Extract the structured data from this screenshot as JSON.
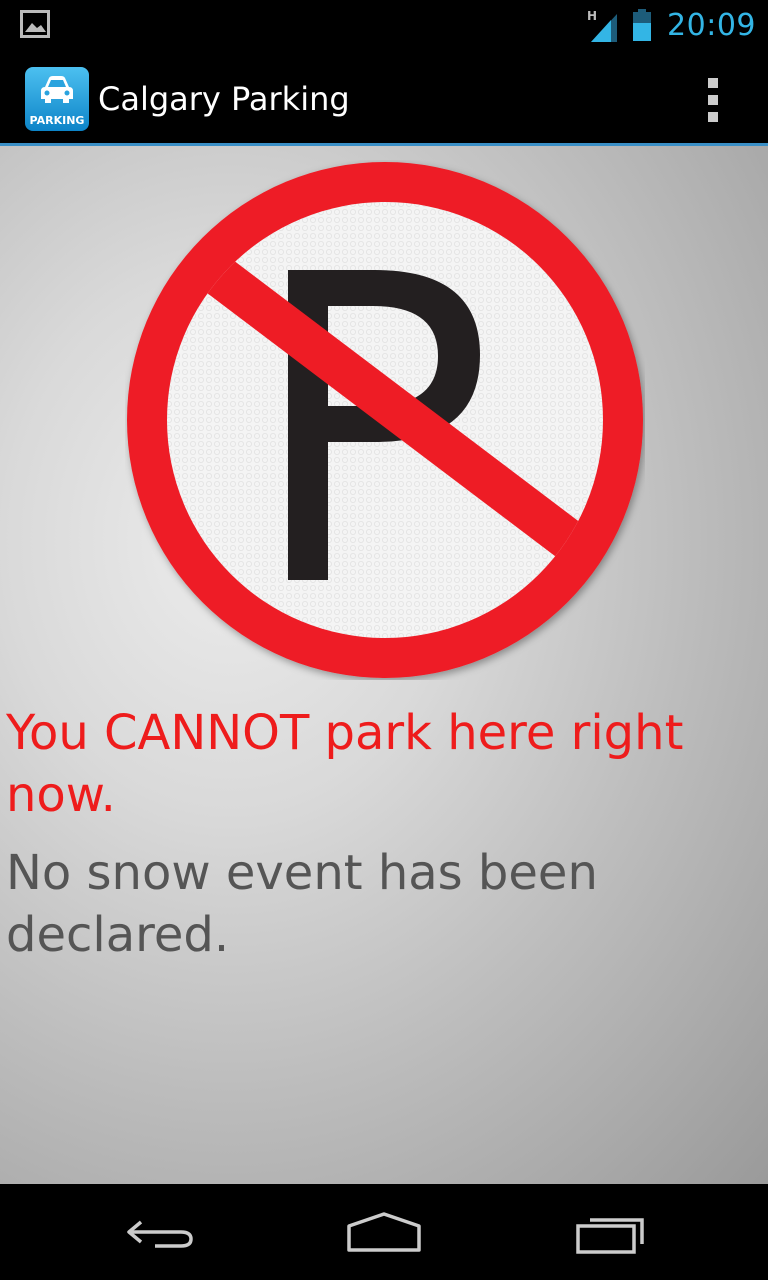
{
  "status_bar": {
    "time": "20:09",
    "network_type": "H",
    "accent_color": "#33b5e5"
  },
  "action_bar": {
    "app_icon_label": "PARKING",
    "title": "Calgary Parking"
  },
  "main": {
    "sign": "no-parking-sign",
    "status_message": "You CANNOT park here right now.",
    "detail_message": "No snow event has been declared.",
    "status_color": "#ee1c1c",
    "detail_color": "#555555"
  },
  "nav_bar": {
    "buttons": [
      "back-icon",
      "home-icon",
      "recents-icon"
    ]
  }
}
